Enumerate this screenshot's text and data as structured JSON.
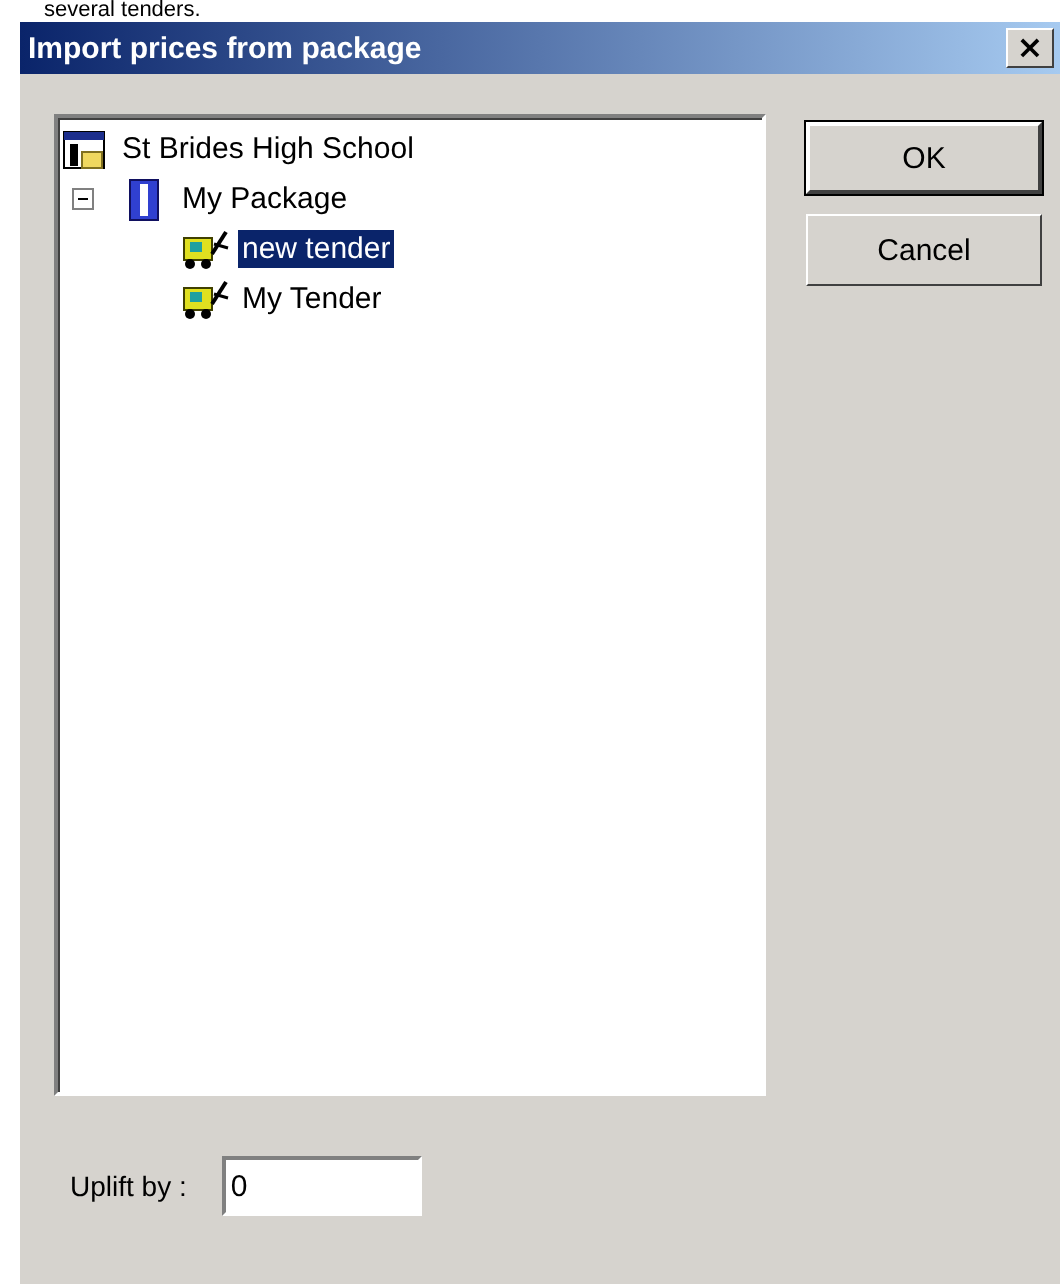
{
  "caption": "several tenders.",
  "window": {
    "title": "Import prices from package",
    "close": "×"
  },
  "tree": [
    {
      "label": "St Brides High School",
      "kind": "site",
      "selected": false,
      "children": [
        {
          "label": "My Package",
          "kind": "package",
          "selected": false,
          "expanded": true,
          "children": [
            {
              "label": "new tender",
              "kind": "tender",
              "selected": true
            },
            {
              "label": "My Tender",
              "kind": "tender",
              "selected": false
            }
          ]
        }
      ]
    }
  ],
  "buttons": [
    {
      "label": "OK",
      "default": true
    },
    {
      "label": "Cancel",
      "default": false
    }
  ],
  "uplift": {
    "label": "Uplift by :",
    "value": "0"
  }
}
